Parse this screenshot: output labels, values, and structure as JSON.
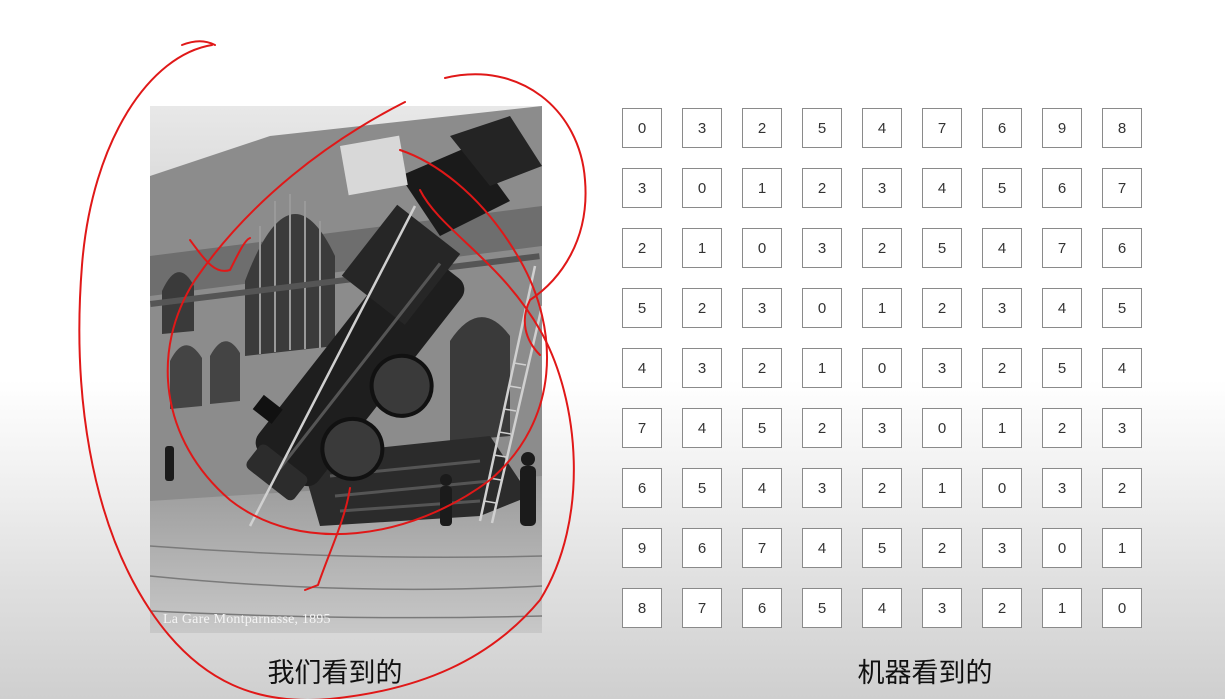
{
  "photo": {
    "caption": "La Gare Montparnasse, 1895"
  },
  "captions": {
    "left": "我们看到的",
    "right": "机器看到的"
  },
  "annotation": {
    "color": "#e01818"
  },
  "matrix": [
    [
      "0",
      "3",
      "2",
      "5",
      "4",
      "7",
      "6",
      "9",
      "8"
    ],
    [
      "3",
      "0",
      "1",
      "2",
      "3",
      "4",
      "5",
      "6",
      "7"
    ],
    [
      "2",
      "1",
      "0",
      "3",
      "2",
      "5",
      "4",
      "7",
      "6"
    ],
    [
      "5",
      "2",
      "3",
      "0",
      "1",
      "2",
      "3",
      "4",
      "5"
    ],
    [
      "4",
      "3",
      "2",
      "1",
      "0",
      "3",
      "2",
      "5",
      "4"
    ],
    [
      "7",
      "4",
      "5",
      "2",
      "3",
      "0",
      "1",
      "2",
      "3"
    ],
    [
      "6",
      "5",
      "4",
      "3",
      "2",
      "1",
      "0",
      "3",
      "2"
    ],
    [
      "9",
      "6",
      "7",
      "4",
      "5",
      "2",
      "3",
      "0",
      "1"
    ],
    [
      "8",
      "7",
      "6",
      "5",
      "4",
      "3",
      "2",
      "1",
      "0"
    ]
  ]
}
